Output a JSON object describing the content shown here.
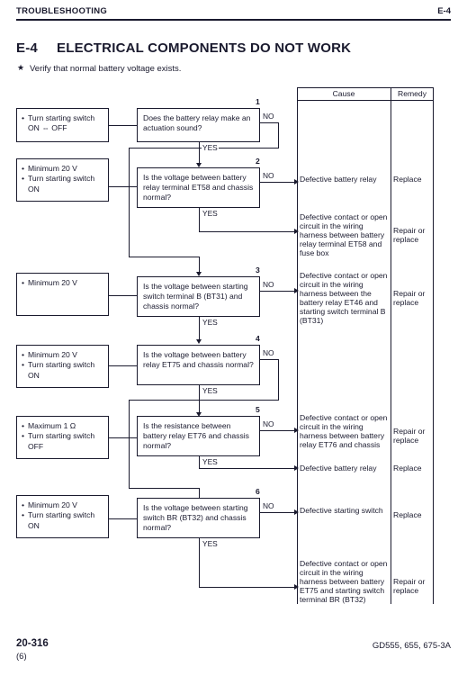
{
  "header": {
    "left": "TROUBLESHOOTING",
    "right": "E-4"
  },
  "title": {
    "id": "E-4",
    "text": "ELECTRICAL COMPONENTS DO NOT WORK"
  },
  "note": {
    "marker": "★",
    "text": "Verify that normal battery voltage exists."
  },
  "labels": {
    "yes": "YES",
    "no": "NO"
  },
  "table": {
    "header": {
      "cause": "Cause",
      "remedy": "Remedy"
    },
    "rows": [
      {
        "cause": "Defective battery relay",
        "remedy": "Replace"
      },
      {
        "cause": "Defective contact or open circuit in the wiring harness between battery relay terminal ET58 and fuse box",
        "remedy": "Repair or replace"
      },
      {
        "cause": "Defective contact or open circuit in the wiring harness between the battery relay ET46 and starting switch terminal B (BT31)",
        "remedy": "Repair or replace"
      },
      {
        "cause": "Defective contact or open circuit in the wiring harness between battery relay ET76 and chassis",
        "remedy": "Repair or replace"
      },
      {
        "cause": "Defective battery relay",
        "remedy": "Replace"
      },
      {
        "cause": "Defective starting switch",
        "remedy": "Replace"
      },
      {
        "cause": "Defective contact or open circuit in the wiring harness between battery ET75 and starting switch terminal BR (BT32)",
        "remedy": "Repair or replace"
      }
    ]
  },
  "flow": {
    "steps": [
      {
        "number": "1",
        "conditions": [
          "Turn starting switch ON ⇔ OFF"
        ],
        "question": "Does the battery relay make an actuation sound?"
      },
      {
        "number": "2",
        "conditions": [
          "Minimum 20 V",
          "Turn starting switch ON"
        ],
        "question": "Is the voltage between battery relay terminal ET58 and chassis normal?"
      },
      {
        "number": "3",
        "conditions": [
          "Minimum 20 V"
        ],
        "question": "Is the voltage between starting switch terminal B (BT31) and chassis normal?"
      },
      {
        "number": "4",
        "conditions": [
          "Minimum 20 V",
          "Turn starting switch ON"
        ],
        "question": "Is the voltage between battery relay ET75 and chassis normal?"
      },
      {
        "number": "5",
        "conditions": [
          "Maximum 1 Ω",
          "Turn starting switch OFF"
        ],
        "question": "Is the resistance between battery relay ET76 and chassis normal?"
      },
      {
        "number": "6",
        "conditions": [
          "Minimum 20 V",
          "Turn starting switch ON"
        ],
        "question": "Is the voltage between starting switch BR (BT32) and chassis normal?"
      }
    ]
  },
  "footer": {
    "page": "20-316",
    "sub": "(6)",
    "model": "GD555, 655, 675-3A"
  }
}
